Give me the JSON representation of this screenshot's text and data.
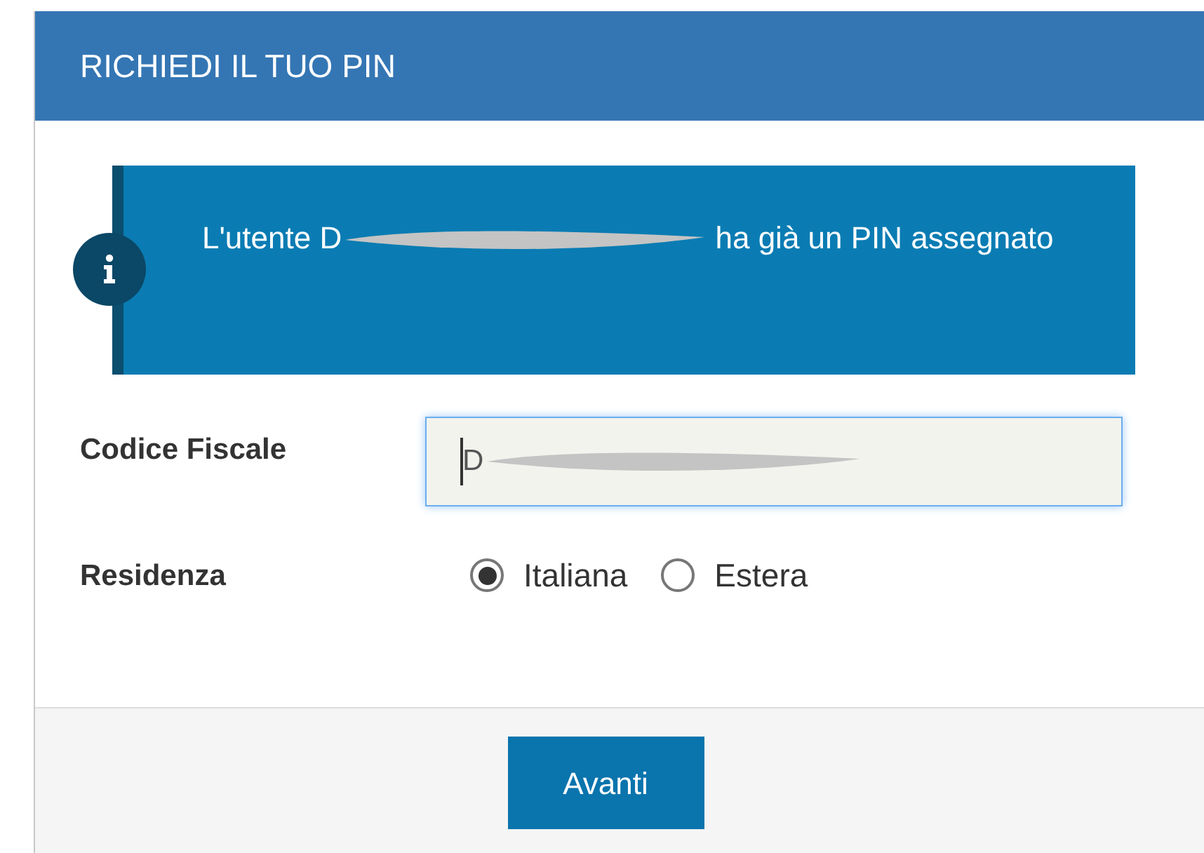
{
  "panel": {
    "title": "RICHIEDI IL TUO PIN"
  },
  "alert": {
    "text_before": "L'utente D",
    "text_after": "ha già un PIN assegnato"
  },
  "fields": [
    {
      "kind": "text",
      "label": "Codice Fiscale",
      "value": "D",
      "focused": true
    },
    {
      "kind": "radio",
      "label": "Residenza",
      "options": [
        {
          "label": "Italiana",
          "selected": true
        },
        {
          "label": "Estera",
          "selected": false
        }
      ]
    }
  ],
  "buttons": [
    "Avanti"
  ]
}
